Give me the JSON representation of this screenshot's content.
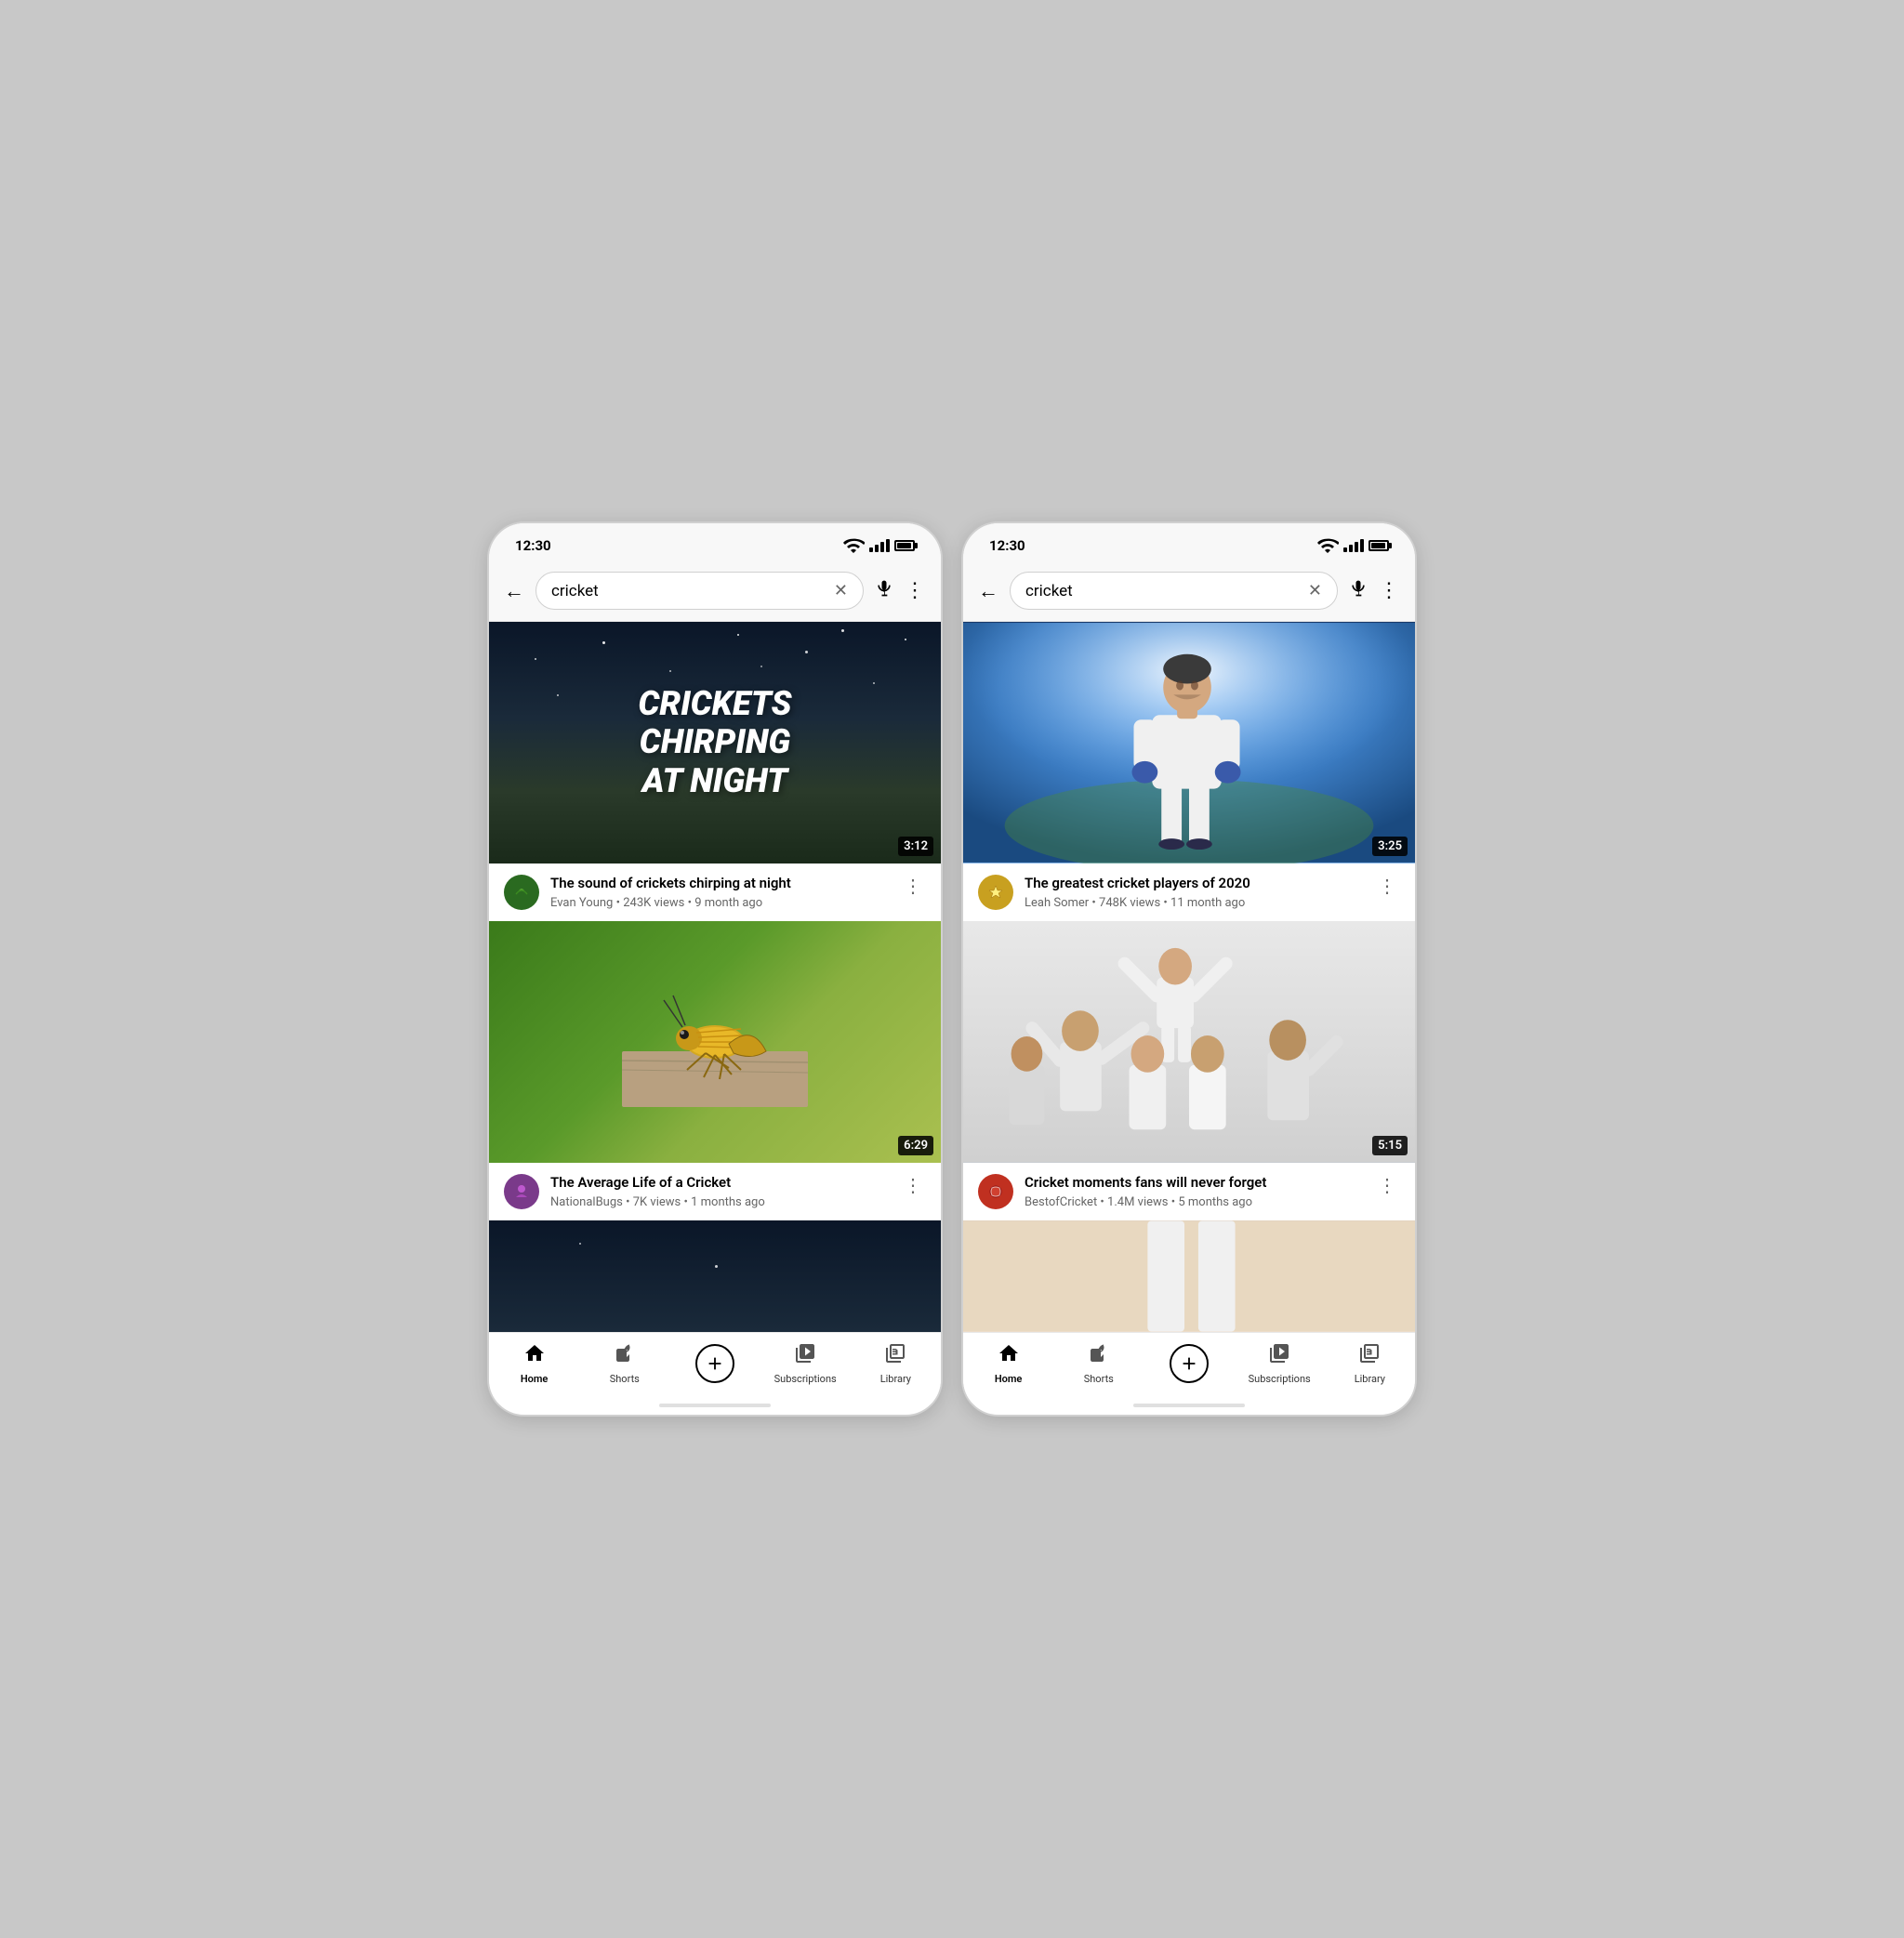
{
  "phones": [
    {
      "id": "phone-left",
      "status_bar": {
        "time": "12:30"
      },
      "search": {
        "query": "cricket",
        "back_label": "←",
        "clear_label": "✕",
        "mic_label": "🎙",
        "more_label": "⋮"
      },
      "videos": [
        {
          "id": "vid1",
          "thumbnail_type": "night",
          "thumbnail_text_line1": "CRICKETS",
          "thumbnail_text_line2": "CHIRPING",
          "thumbnail_text_line3": "AT NIGHT",
          "duration": "3:12",
          "title": "The sound of crickets chirping at night",
          "channel": "Evan Young",
          "views": "243K views",
          "age": "9 month ago",
          "avatar_type": "ev",
          "avatar_text": "🌿"
        },
        {
          "id": "vid2",
          "thumbnail_type": "bug",
          "duration": "6:29",
          "title": "The Average Life of a Cricket",
          "channel": "NationalBugs",
          "views": "7K views",
          "age": "1 months ago",
          "avatar_type": "nb",
          "avatar_text": "🦋"
        },
        {
          "id": "vid3",
          "thumbnail_type": "partial",
          "duration": "",
          "title": "",
          "channel": "",
          "views": "",
          "age": ""
        }
      ],
      "nav": {
        "items": [
          {
            "id": "home",
            "label": "Home",
            "active": true
          },
          {
            "id": "shorts",
            "label": "Shorts",
            "active": false
          },
          {
            "id": "add",
            "label": "",
            "active": false
          },
          {
            "id": "subscriptions",
            "label": "Subscriptions",
            "active": false
          },
          {
            "id": "library",
            "label": "Library",
            "active": false
          }
        ]
      }
    },
    {
      "id": "phone-right",
      "status_bar": {
        "time": "12:30"
      },
      "search": {
        "query": "cricket",
        "back_label": "←",
        "clear_label": "✕",
        "mic_label": "🎙",
        "more_label": "⋮"
      },
      "videos": [
        {
          "id": "vid4",
          "thumbnail_type": "player",
          "duration": "3:25",
          "title": "The greatest cricket players of 2020",
          "channel": "Leah Somer",
          "views": "748K views",
          "age": "11 month ago",
          "avatar_type": "ls",
          "avatar_text": "⭐"
        },
        {
          "id": "vid5",
          "thumbnail_type": "celebration",
          "duration": "5:15",
          "title": "Cricket moments fans will never forget",
          "channel": "BestofCricket",
          "views": "1.4M views",
          "age": "5 months ago",
          "avatar_type": "bc",
          "avatar_text": "🏏"
        },
        {
          "id": "vid6",
          "thumbnail_type": "partial-right",
          "duration": "",
          "title": "",
          "channel": "",
          "views": "",
          "age": ""
        }
      ],
      "nav": {
        "items": [
          {
            "id": "home",
            "label": "Home",
            "active": true
          },
          {
            "id": "shorts",
            "label": "Shorts",
            "active": false
          },
          {
            "id": "add",
            "label": "",
            "active": false
          },
          {
            "id": "subscriptions",
            "label": "Subscriptions",
            "active": false
          },
          {
            "id": "library",
            "label": "Library",
            "active": false
          }
        ]
      }
    }
  ]
}
